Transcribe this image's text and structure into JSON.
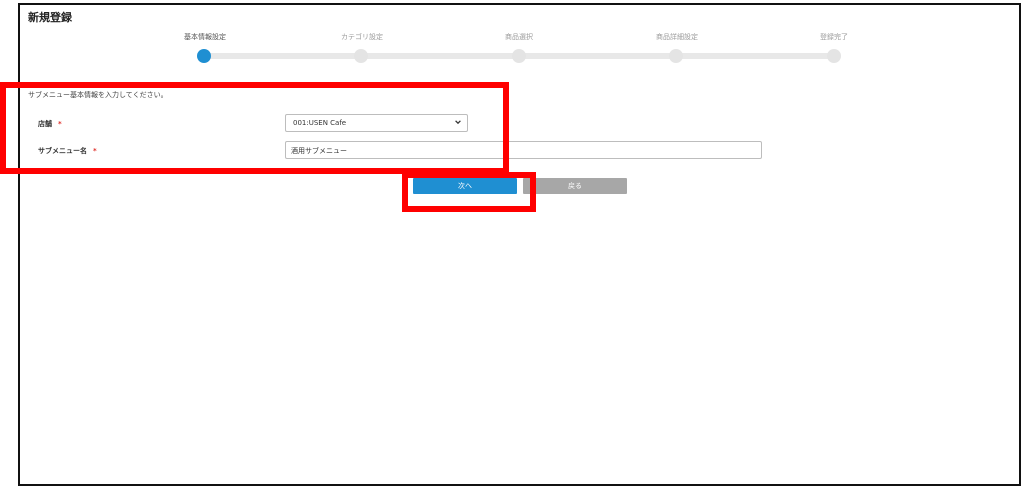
{
  "page": {
    "title": "新規登録"
  },
  "stepper": {
    "steps": [
      {
        "label": "基本情報設定",
        "active": true
      },
      {
        "label": "カテゴリ設定",
        "active": false
      },
      {
        "label": "商品選択",
        "active": false
      },
      {
        "label": "商品詳細設定",
        "active": false
      },
      {
        "label": "登録完了",
        "active": false
      }
    ],
    "active_color": "#1f8fd2"
  },
  "form": {
    "instruction": "サブメニュー基本情報を入力してください。",
    "store": {
      "label": "店舗",
      "required_mark": "*",
      "value": "001:USEN Cafe"
    },
    "submenu_name": {
      "label": "サブメニュー名",
      "required_mark": "*",
      "value": "酒用サブメニュー"
    }
  },
  "buttons": {
    "next_label": "次へ",
    "back_label": "戻る"
  },
  "annotations": {
    "highlight_color": "#ff0000"
  }
}
